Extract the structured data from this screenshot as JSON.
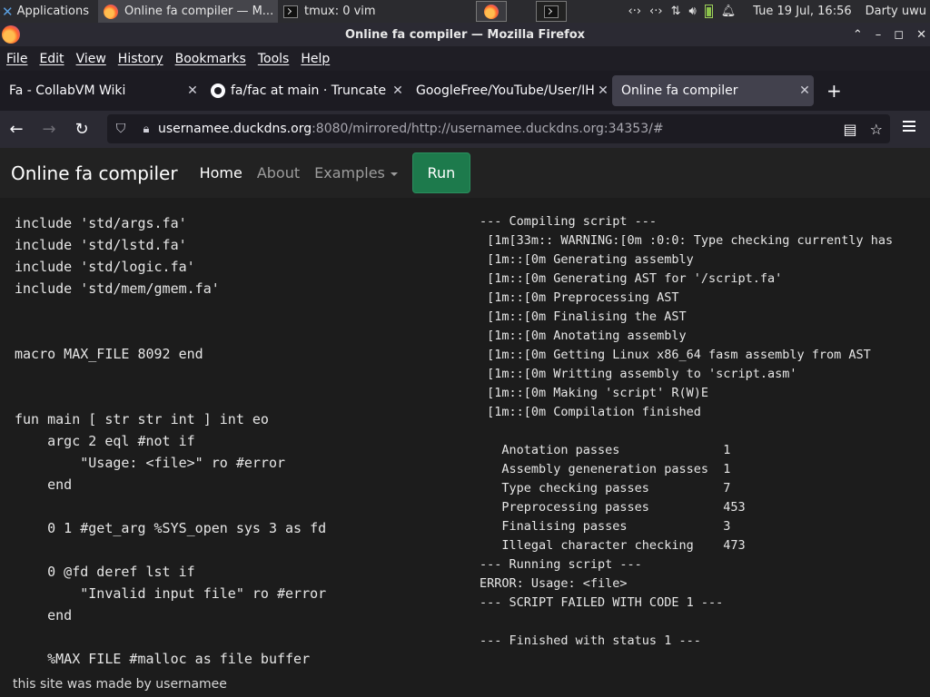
{
  "taskbar": {
    "apps_label": "Applications",
    "tasks": [
      {
        "label": "Online fa compiler — M..."
      },
      {
        "label": "tmux: 0 vim"
      }
    ],
    "clock": "Tue 19 Jul, 16:56",
    "user": "Darty uwu",
    "tray_icons": [
      "network-icon",
      "network-icon",
      "updown-icon",
      "volume-icon",
      "battery-icon",
      "bell-icon"
    ]
  },
  "window": {
    "title": "Online fa compiler — Mozilla Firefox"
  },
  "menu": [
    "File",
    "Edit",
    "View",
    "History",
    "Bookmarks",
    "Tools",
    "Help"
  ],
  "tabs": [
    {
      "label": "Fa - CollabVM Wiki",
      "active": false
    },
    {
      "label": "fa/fac at main · Truncate",
      "active": false
    },
    {
      "label": "GoogleFree/YouTube/User/IH",
      "active": false
    },
    {
      "label": "Online fa compiler",
      "active": true
    }
  ],
  "urlbar": {
    "host": "usernamee.duckdns.org",
    "rest": ":8080/mirrored/http://usernamee.duckdns.org:34353/#"
  },
  "site": {
    "brand": "Online fa compiler",
    "nav": [
      {
        "label": "Home",
        "active": true
      },
      {
        "label": "About",
        "active": false
      },
      {
        "label": "Examples",
        "active": false
      }
    ],
    "run_label": "Run",
    "footer": "this site was made by usernamee"
  },
  "editor_lines": [
    "include 'std/args.fa'",
    "include 'std/lstd.fa'",
    "include 'std/logic.fa'",
    "include 'std/mem/gmem.fa'",
    "",
    "",
    "macro MAX_FILE 8092 end",
    "",
    "",
    "fun main [ str str int ] int eo",
    "    argc 2 eql #not if",
    "        \"Usage: <file>\" ro #error",
    "    end",
    "",
    "    0 1 #get_arg %SYS_open sys 3 as fd",
    "",
    "    0 @fd deref lst if",
    "        \"Invalid input file\" ro #error",
    "    end",
    "",
    "    %MAX_FILE #malloc as file_buffer"
  ],
  "output_lines": [
    "--- Compiling script ---",
    " [1m[33m:: WARNING:[0m :0:0: Type checking currently has",
    " [1m::[0m Generating assembly",
    " [1m::[0m Generating AST for '/script.fa'",
    " [1m::[0m Preprocessing AST",
    " [1m::[0m Finalising the AST",
    " [1m::[0m Anotating assembly",
    " [1m::[0m Getting Linux x86_64 fasm assembly from AST",
    " [1m::[0m Writting assembly to 'script.asm'",
    " [1m::[0m Making 'script' R(W)E",
    " [1m::[0m Compilation finished",
    "",
    "   Anotation passes              1",
    "   Assembly geneneration passes  1",
    "   Type checking passes          7",
    "   Preprocessing passes          453",
    "   Finalising passes             3",
    "   Illegal character checking    473",
    "--- Running script ---",
    "ERROR: Usage: <file>",
    "--- SCRIPT FAILED WITH CODE 1 ---",
    "",
    "--- Finished with status 1 ---"
  ]
}
